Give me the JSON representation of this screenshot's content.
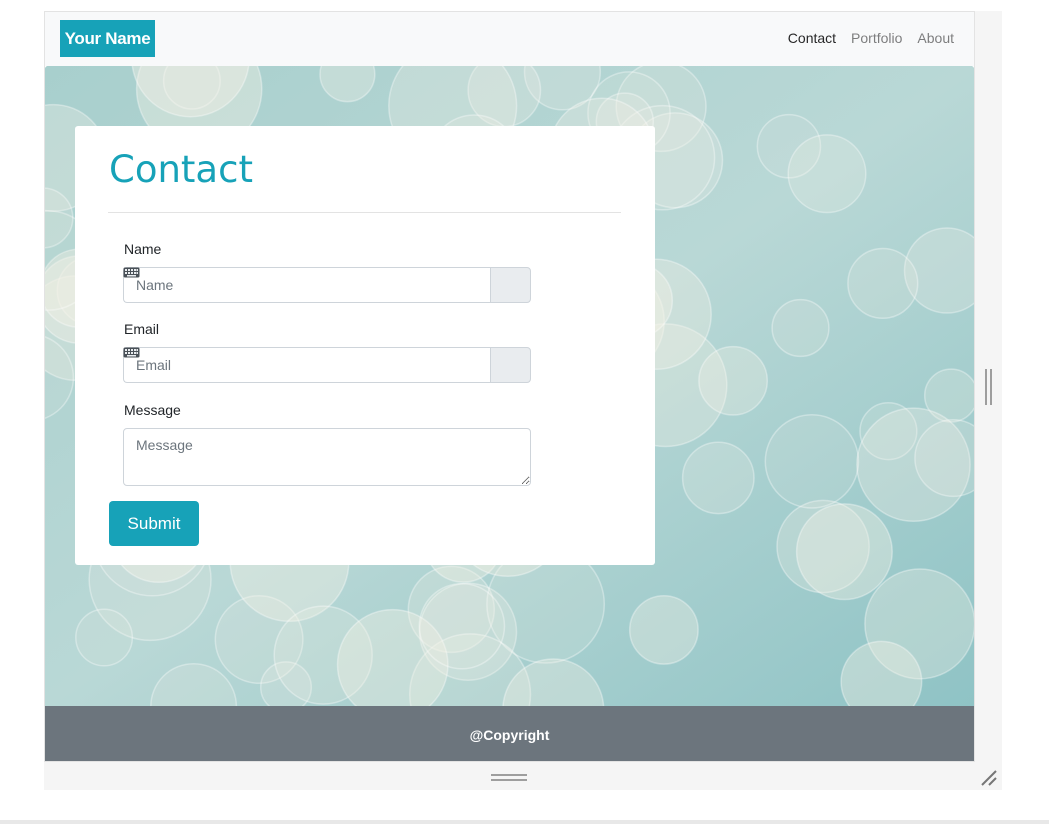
{
  "navbar": {
    "brand": "Your Name",
    "links": [
      {
        "label": "Contact",
        "active": true
      },
      {
        "label": "Portfolio",
        "active": false
      },
      {
        "label": "About",
        "active": false
      }
    ]
  },
  "form": {
    "title": "Contact",
    "name_label": "Name",
    "name_placeholder": "Name",
    "email_label": "Email",
    "email_placeholder": "Email",
    "message_label": "Message",
    "message_placeholder": "Message",
    "submit_label": "Submit",
    "addon_icon": "keyboard-icon"
  },
  "footer": {
    "text": "@Copyright"
  },
  "colors": {
    "accent": "#17a2b8",
    "footer": "#6c757d",
    "navbar_bg": "#f8f9fa",
    "hero_bg": "#9cc9c9"
  }
}
